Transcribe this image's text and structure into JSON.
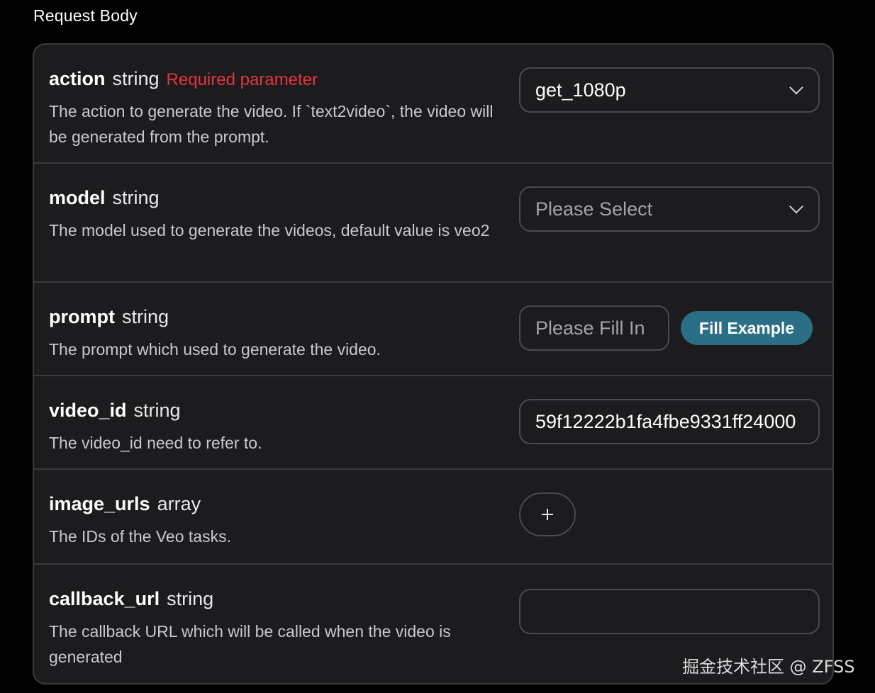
{
  "section": {
    "title": "Request Body"
  },
  "params": [
    {
      "name": "action",
      "type": "string",
      "required": "Required parameter",
      "description": "The action to generate the video. If `text2video`, the video will be generated from the prompt.",
      "control": {
        "kind": "select",
        "value": "get_1080p"
      }
    },
    {
      "name": "model",
      "type": "string",
      "description": "The model used to generate the videos, default value is veo2",
      "control": {
        "kind": "select",
        "placeholder": "Please Select"
      }
    },
    {
      "name": "prompt",
      "type": "string",
      "description": "The prompt which used to generate the video.",
      "control": {
        "kind": "text",
        "placeholder": "Please Fill In",
        "button_label": "Fill Example"
      }
    },
    {
      "name": "video_id",
      "type": "string",
      "description": "The video_id need to refer to.",
      "control": {
        "kind": "text",
        "value": "59f12222b1fa4fbe9331ff24000"
      }
    },
    {
      "name": "image_urls",
      "type": "array",
      "description": "The IDs of the Veo tasks.",
      "control": {
        "kind": "add",
        "icon": "plus-icon"
      }
    },
    {
      "name": "callback_url",
      "type": "string",
      "description": "The callback URL which will be called when the video is generated",
      "control": {
        "kind": "text",
        "value": ""
      }
    }
  ],
  "watermark": "掘金技术社区 @ ZFSS",
  "colors": {
    "background": "#000000",
    "panel": "#1c1c1e",
    "border": "#3a3a3c",
    "required": "#e5333c",
    "button": "#2b6f86"
  }
}
